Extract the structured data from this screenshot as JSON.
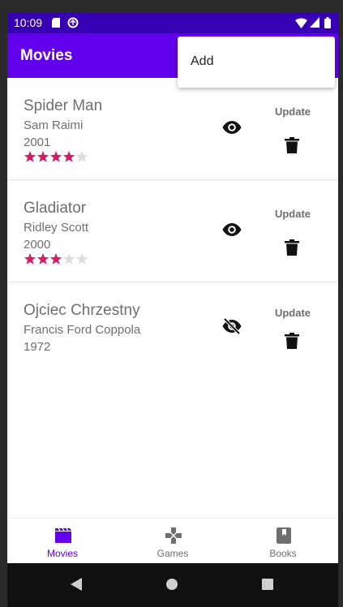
{
  "status_bar": {
    "time": "10:09",
    "icons": [
      "sd-card-icon",
      "sync-icon",
      "wifi-icon",
      "signal-icon",
      "battery-icon"
    ]
  },
  "app_bar": {
    "title": "Movies",
    "background": "#6200ee"
  },
  "overflow_menu": {
    "items": [
      {
        "label": "Add"
      }
    ]
  },
  "movies": [
    {
      "title": "Spider Man",
      "director": "Sam Raimi",
      "year": "2001",
      "rating": 4,
      "max_rating": 5,
      "watched": true,
      "update_label": "Update"
    },
    {
      "title": "Gladiator",
      "director": "Ridley Scott",
      "year": "2000",
      "rating": 3,
      "max_rating": 5,
      "watched": true,
      "update_label": "Update"
    },
    {
      "title": "Ojciec Chrzestny",
      "director": "Francis Ford Coppola",
      "year": "1972",
      "rating": null,
      "max_rating": 5,
      "watched": false,
      "update_label": "Update"
    }
  ],
  "bottom_nav": {
    "items": [
      {
        "label": "Movies",
        "icon": "movie-icon",
        "active": true
      },
      {
        "label": "Games",
        "icon": "gamepad-icon",
        "active": false
      },
      {
        "label": "Books",
        "icon": "book-icon",
        "active": false
      }
    ]
  },
  "colors": {
    "status_bar": "#3700b3",
    "primary": "#6200ee",
    "star_filled": "#d81b60",
    "star_empty": "#dddddd"
  }
}
